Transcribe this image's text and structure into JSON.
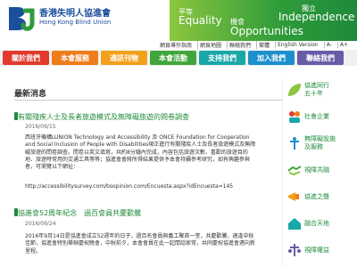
{
  "header": {
    "org_cn": "香港失明人協進會",
    "org_en": "Hong Kong Blind Union",
    "banner": {
      "t1": "平等",
      "t2": "Equality",
      "t3": "機會",
      "t4": "Opportunities",
      "t5": "獨立",
      "t6": "Independence"
    }
  },
  "topbar": {
    "links": [
      "網頁導作指南",
      "網頁地圖",
      "聯絡我們",
      "繁體",
      "English Version",
      "A-",
      "A+"
    ]
  },
  "nav": {
    "items": [
      {
        "label": "關於我們",
        "color": "#e23a2d"
      },
      {
        "label": "本會服務",
        "color": "#ef7c1a"
      },
      {
        "label": "通訊刊物",
        "color": "#f2a11b"
      },
      {
        "label": "本會活動",
        "color": "#41a63a"
      },
      {
        "label": "支持我們",
        "color": "#19a7a8"
      },
      {
        "label": "加入我們",
        "color": "#1d8fcc"
      },
      {
        "label": "聯絡我們",
        "color": "#6a5ba8"
      }
    ]
  },
  "main": {
    "section_title": "最新消息",
    "news1": {
      "title": "有關殘疾人士及長者旅遊模式及無障礙旅遊的問卷調查",
      "date": "2016/09/15",
      "body": "西班牙機構LUNION Technology and Accessibility 及 ONCE Foundation for Cooperation and Social Inclusion of People with Disabilities現正進行有關殘疾人士及長者旅遊模式及無障礙旅遊的問卷調查。問卷以英文填寫，共約8分鐘內完成，內容包括旅遊次數、喜歡的旅遊目的地、旅遊時常用的交通工具等等；協進會會將所得結果提供予本會持續參考研究，如有興趣參與者，可瀏覽以下網址：",
      "link": "http://accessibilitysurvey.com/bsopinion.com/Encuesta.aspx?idEncuesta=145"
    },
    "news2": {
      "title": "協進會52周年紀念　過百會員共慶歡騰",
      "date": "2016/09/24",
      "body": "2016年9月14日是協進會成立52週年的日子，過百名會員與義工聚首一堂，共慶歡騰，適逢中秋佳節，協進會特別舉辦慶祝晚會，中秋前夕，本會會員在此一起閒話家常，共同慶祝協進會邁向新里程。"
    }
  },
  "sidebar": {
    "items": [
      {
        "label": "協進同行\n五十年"
      },
      {
        "label": "社會企業"
      },
      {
        "label": "無障礙設施\n及服務"
      },
      {
        "label": "視障共融"
      },
      {
        "label": "協進之聲"
      },
      {
        "label": "融合天地"
      },
      {
        "label": "視障權益"
      }
    ]
  },
  "colors": {
    "brand_green": "#1f8a3b",
    "brand_blue": "#1b4f9c"
  }
}
